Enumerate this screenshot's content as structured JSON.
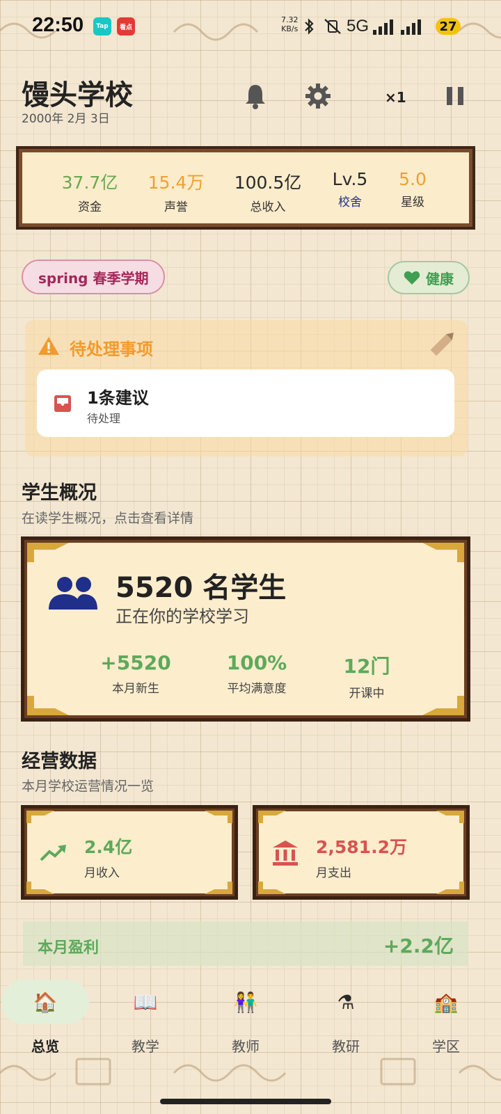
{
  "status_bar": {
    "time": "22:50",
    "app_icons": [
      {
        "name": "taptap-icon",
        "text": "Tap",
        "color": "#19c7c7"
      },
      {
        "name": "news-app-icon",
        "text": "看点",
        "color": "#e53935"
      }
    ],
    "net_speed_value": "7.32",
    "net_speed_unit": "KB/s",
    "network": "5G",
    "battery": "27"
  },
  "header": {
    "school_name": "馒头学校",
    "date": "2000年 2月 3日",
    "speed": "×1",
    "icons": [
      "bell-icon",
      "gear-icon",
      "pause-icon"
    ]
  },
  "stats": [
    {
      "value": "37.7亿",
      "label": "资金",
      "color": "#6aa84f",
      "label_color": "#333333"
    },
    {
      "value": "15.4万",
      "label": "声誉",
      "color": "#f0a030",
      "label_color": "#333333"
    },
    {
      "value": "100.5亿",
      "label": "总收入",
      "color": "#2a2a2a",
      "label_color": "#333333"
    },
    {
      "value": "Lv.5",
      "label": "校舍",
      "color": "#2a2a2a",
      "label_color": "#1f2f8a"
    },
    {
      "value": "5.0",
      "label": "星级",
      "color": "#f0a030",
      "label_color": "#333333"
    }
  ],
  "season_chip": "spring 春季学期",
  "health_chip": "健康",
  "pending": {
    "title": "待处理事项",
    "item_title": "1条建议",
    "item_sub": "待处理"
  },
  "students": {
    "section_title": "学生概况",
    "section_sub": "在读学生概况，点击查看详情",
    "count": "5520 名学生",
    "sub": "正在你的学校学习",
    "stats": [
      {
        "value": "+5520",
        "label": "本月新生"
      },
      {
        "value": "100%",
        "label": "平均满意度"
      },
      {
        "value": "12门",
        "label": "开课中"
      }
    ]
  },
  "operations": {
    "section_title": "经营数据",
    "section_sub": "本月学校运营情况一览",
    "income_value": "2.4亿",
    "income_label": "月收入",
    "expense_value": "2,581.2万",
    "expense_label": "月支出",
    "profit_label": "本月盈利",
    "profit_value": "+2.2亿",
    "colors": {
      "positive": "#5ea95b",
      "negative": "#d9534f"
    }
  },
  "nav": [
    {
      "label": "总览",
      "icon": "school-house-icon",
      "glyph": "🏠",
      "active": true
    },
    {
      "label": "教学",
      "icon": "book-icon",
      "glyph": "📖",
      "active": false
    },
    {
      "label": "教师",
      "icon": "teachers-icon",
      "glyph": "👫",
      "active": false
    },
    {
      "label": "教研",
      "icon": "flask-icon",
      "glyph": "⚗",
      "active": false
    },
    {
      "label": "学区",
      "icon": "campus-building-icon",
      "glyph": "🏫",
      "active": false
    }
  ]
}
